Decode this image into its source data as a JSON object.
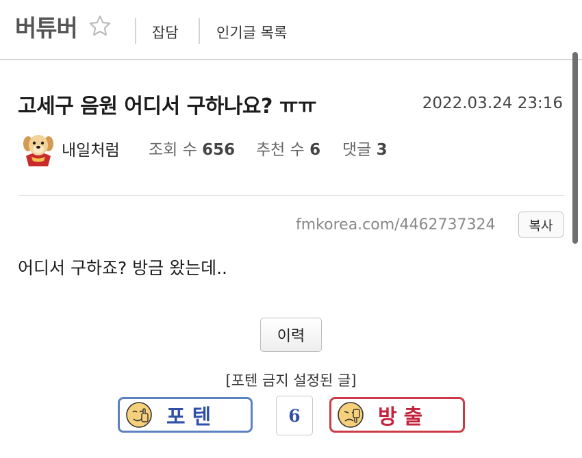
{
  "header": {
    "board_name": "버튜버",
    "nav": [
      "잡담",
      "인기글 목록"
    ]
  },
  "post": {
    "title": "고세구 음원 어디서 구하나요? ㅠㅠ",
    "date": "2022.03.24 23:16",
    "author": "내일처럼",
    "stats": [
      {
        "label": "조회 수",
        "value": "656"
      },
      {
        "label": "추천 수",
        "value": "6"
      },
      {
        "label": "댓글",
        "value": "3"
      }
    ],
    "url": "fmkorea.com/4462737324",
    "copy_label": "복사",
    "content": "어디서 구하죠? 방금 왔는데.."
  },
  "actions": {
    "history_label": "이력",
    "notice": "[포텐 금지 설정된 글]",
    "upvote_label": "포텐",
    "vote_count": "6",
    "downvote_label": "방출"
  },
  "icons": {
    "favorite": "star-outline-icon",
    "avatar": "puppy-avatar-icon",
    "upvote": "thumbs-up-face-icon",
    "downvote": "thumbs-down-face-icon"
  },
  "colors": {
    "upvote_border": "#5b82bf",
    "upvote_text": "#2f4fa8",
    "downvote_border": "#cc3a48",
    "downvote_text": "#c4213a"
  }
}
